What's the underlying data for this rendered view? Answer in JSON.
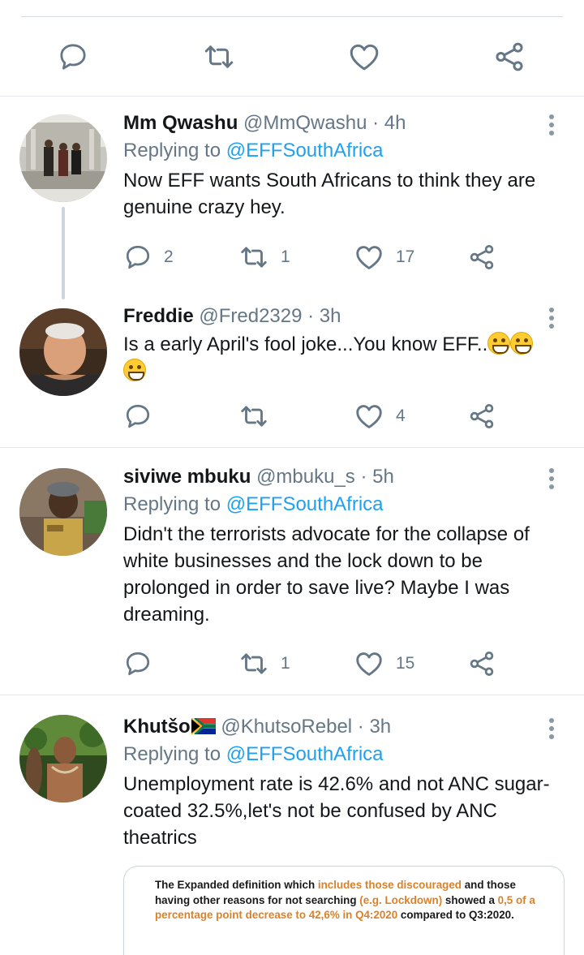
{
  "colors": {
    "link": "#1da1f2",
    "muted": "#657786",
    "text": "#14171a",
    "highlight": "#d9822b"
  },
  "icons": {
    "reply": "reply-icon",
    "retweet": "retweet-icon",
    "like": "heart-icon",
    "share": "share-icon",
    "more": "more-vertical-icon"
  },
  "tweets": [
    {
      "name": "Mm Qwashu",
      "handle": "@MmQwashu",
      "time": "· 4h",
      "replying_prefix": "Replying to",
      "replying_to": "@EFFSouthAfrica",
      "text": "Now EFF wants South Africans to think they are genuine crazy hey.",
      "replies": "2",
      "retweets": "1",
      "likes": "17"
    },
    {
      "name": "Freddie",
      "handle": "@Fred2329",
      "time": "· 3h",
      "text": "Is a early April's fool joke...You know EFF..",
      "emoji": "grinning-face",
      "replies": "",
      "retweets": "",
      "likes": "4"
    },
    {
      "name": "siviwe mbuku",
      "handle": "@mbuku_s",
      "time": "· 5h",
      "replying_prefix": "Replying to",
      "replying_to": "@EFFSouthAfrica",
      "text": "Didn't the terrorists advocate for the collapse of white businesses and the lock down to be prolonged in order to save live? Maybe I was dreaming.",
      "replies": "",
      "retweets": "1",
      "likes": "15"
    },
    {
      "name": "Khutšo",
      "flag": "south-africa-flag",
      "handle": "@KhutsoRebel",
      "time": "· 3h",
      "replying_prefix": "Replying to",
      "replying_to": "@EFFSouthAfrica",
      "text": "Unemployment rate is 42.6% and not ANC sugar-coated 32.5%,let's not be confused by ANC theatrics",
      "media": {
        "p1": "The Expanded definition which ",
        "p2": "includes those discouraged",
        "p3": " and those having other reasons for not searching ",
        "p4": "(e.g. Lockdown)",
        "p5": " showed a ",
        "p6": "0,5 of a percentage point decrease to 42,6% in Q4:2020",
        "p7": " compared to Q3:2020."
      }
    }
  ]
}
